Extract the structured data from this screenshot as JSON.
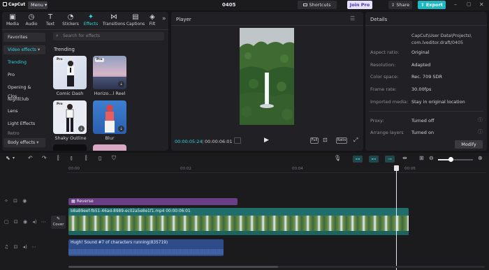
{
  "app": {
    "logo": "CapCut",
    "menu_label": "Menu",
    "project_name": "0405",
    "shortcuts_label": "Shortcuts",
    "joinpro_label": "Join Pro",
    "share_label": "Share",
    "export_label": "Export"
  },
  "toolbar": [
    {
      "label": "Media",
      "icon": "media-icon"
    },
    {
      "label": "Audio",
      "icon": "audio-icon"
    },
    {
      "label": "Text",
      "icon": "text-icon"
    },
    {
      "label": "Stickers",
      "icon": "stickers-icon"
    },
    {
      "label": "Effects",
      "icon": "effects-icon"
    },
    {
      "label": "Transitions",
      "icon": "transitions-icon"
    },
    {
      "label": "Captions",
      "icon": "captions-icon"
    },
    {
      "label": "Filt",
      "icon": "filters-icon"
    }
  ],
  "sidebar": {
    "favorites": "Favorites",
    "video_effects": "Video effects",
    "items": [
      "Trending",
      "Pro",
      "Opening & Clos...",
      "Nightclub",
      "Lens",
      "Light Effects",
      "Retro"
    ],
    "body_effects": "Body effects"
  },
  "effects": {
    "search_placeholder": "Search for effects",
    "section_title": "Trending",
    "pro_badge": "Pro",
    "cards": [
      "Comic Dash",
      "Horizo...l Reel",
      "Shaky Outline",
      "Blur"
    ]
  },
  "player": {
    "title": "Player",
    "current_time": "00:00:05:24",
    "total_time": "00:00:06:01",
    "full_label": "Full",
    "ratio_label": "Ratio"
  },
  "details": {
    "title": "Details",
    "path_line1": "CapCut\\User Data\\Projects\\",
    "path_line2": "com.lveditor.draft/0405",
    "rows": [
      {
        "key": "Aspect ratio:",
        "value": "Original"
      },
      {
        "key": "Resolution:",
        "value": "Adapted"
      },
      {
        "key": "Color space:",
        "value": "Rec. 709 SDR"
      },
      {
        "key": "Frame rate:",
        "value": "30.00fps"
      },
      {
        "key": "Imported media:",
        "value": "Stay in original location"
      },
      {
        "key": "Proxy:",
        "value": "Turned off"
      },
      {
        "key": "Arrange layers",
        "value": "Turned on"
      }
    ],
    "modify_label": "Modify"
  },
  "timeline": {
    "ruler": [
      "00:00",
      "00:02",
      "00:04",
      "00:06"
    ],
    "effect_clip": "Reverse",
    "video_clip": "b8a89eef-fb51-46ad-8989-ec02a5e8e1f1.mp4   00:00:06:01",
    "cover_label": "Cover",
    "audio_clip": "Hugh! Sound #7 of characters running(835719)"
  },
  "colors": {
    "accent": "#32d6e0",
    "effect_clip": "#6b3f85",
    "video_clip": "#1f6e6c",
    "audio_clip": "#2f4c8a",
    "export": "#1fb9c4"
  }
}
